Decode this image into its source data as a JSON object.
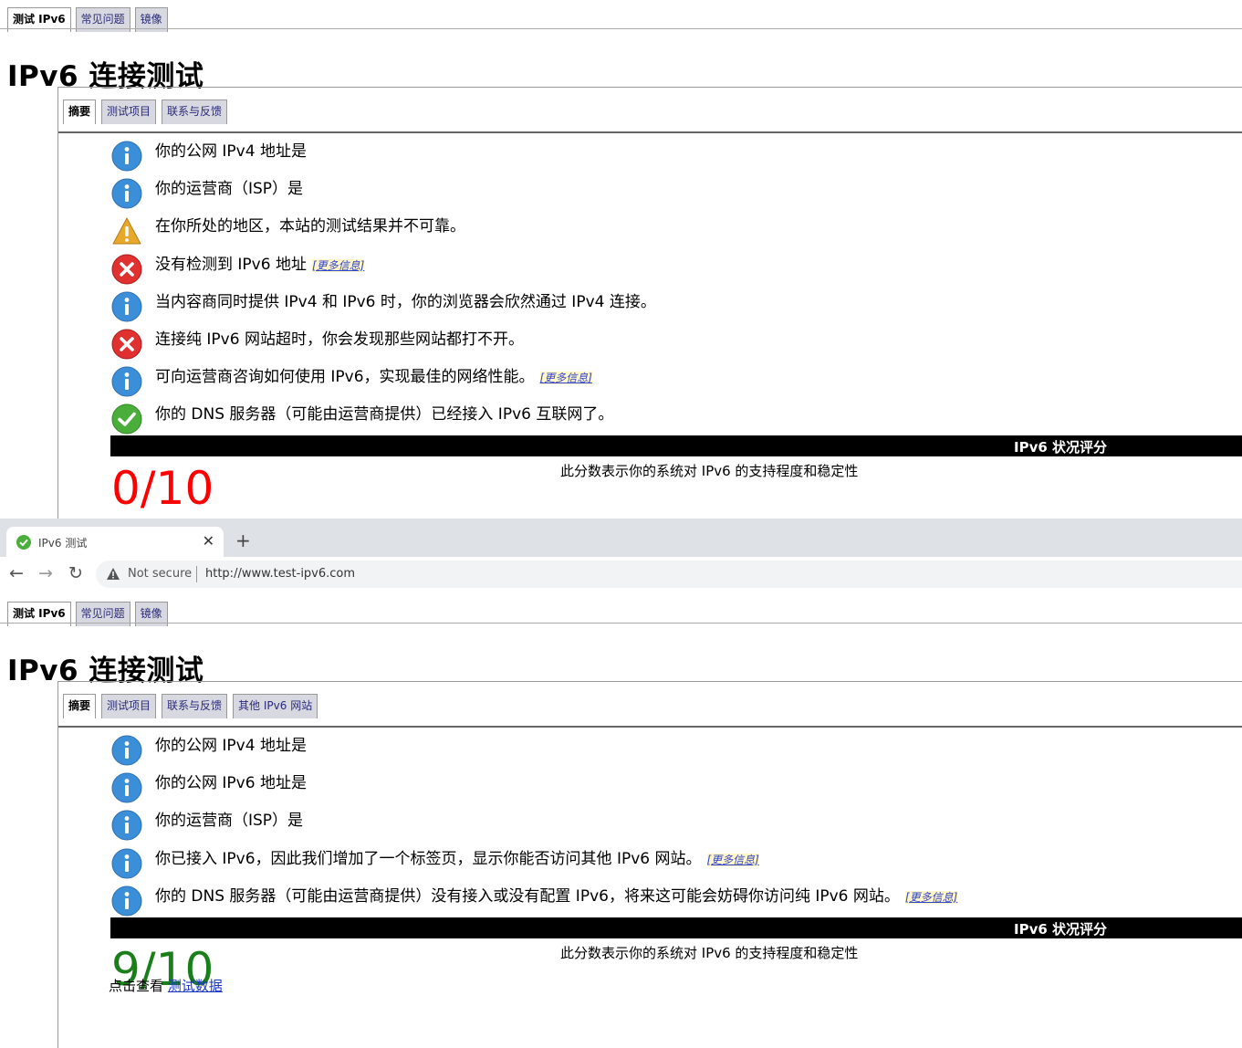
{
  "screenshot1": {
    "top_tabs": [
      "测试 IPv6",
      "常见问题",
      "镜像"
    ],
    "title": "IPv6 连接测试",
    "sub_tabs": [
      "摘要",
      "测试项目",
      "联系与反馈"
    ],
    "messages": [
      {
        "icon": "info",
        "text": "你的公网 IPv4 地址是",
        "more": ""
      },
      {
        "icon": "info",
        "text": "你的运营商（ISP）是",
        "more": ""
      },
      {
        "icon": "warning",
        "text": "在你所处的地区，本站的测试结果并不可靠。",
        "more": ""
      },
      {
        "icon": "error",
        "text": "没有检测到 IPv6 地址",
        "more": "[更多信息]"
      },
      {
        "icon": "info",
        "text": "当内容商同时提供 IPv4 和 IPv6 时，你的浏览器会欣然通过 IPv4 连接。",
        "more": ""
      },
      {
        "icon": "error",
        "text": "连接纯 IPv6 网站超时，你会发现那些网站都打不开。",
        "more": ""
      },
      {
        "icon": "info",
        "text": "可向运营商咨询如何使用 IPv6，实现最佳的网络性能。",
        "more": "[更多信息]"
      },
      {
        "icon": "ok",
        "text": "你的 DNS 服务器（可能由运营商提供）已经接入 IPv6 互联网了。",
        "more": ""
      }
    ],
    "score_heading": "IPv6 状况评分",
    "score_desc": "此分数表示你的系统对 IPv6 的支持程度和稳定性",
    "score": "0/10",
    "score_color": "#ff0000"
  },
  "browser": {
    "tab_title": "IPv6 测试",
    "security": "Not secure",
    "url": "http://www.test-ipv6.com"
  },
  "screenshot2": {
    "top_tabs": [
      "测试 IPv6",
      "常见问题",
      "镜像"
    ],
    "title": "IPv6 连接测试",
    "sub_tabs": [
      "摘要",
      "测试项目",
      "联系与反馈",
      "其他 IPv6 网站"
    ],
    "messages": [
      {
        "icon": "info",
        "text": "你的公网 IPv4 地址是",
        "more": ""
      },
      {
        "icon": "info",
        "text": "你的公网 IPv6 地址是",
        "more": ""
      },
      {
        "icon": "info",
        "text": "你的运营商（ISP）是",
        "more": ""
      },
      {
        "icon": "info",
        "text": "你已接入 IPv6，因此我们增加了一个标签页，显示你能否访问其他 IPv6 网站。",
        "more": "[更多信息]"
      },
      {
        "icon": "info",
        "text": "你的 DNS 服务器（可能由运营商提供）没有接入或没有配置 IPv6，将来这可能会妨碍你访问纯 IPv6 网站。",
        "more": "[更多信息]"
      }
    ],
    "score_heading": "IPv6 状况评分",
    "score_desc": "此分数表示你的系统对 IPv6 的支持程度和稳定性",
    "score": "9/10",
    "score_color": "#1a7f1a",
    "footer_text": "点击查看",
    "footer_link": "测试数据"
  },
  "colors": {
    "info": "#3b8fd9",
    "error": "#e03030",
    "warning": "#e8a82a",
    "ok": "#4aae3a"
  }
}
